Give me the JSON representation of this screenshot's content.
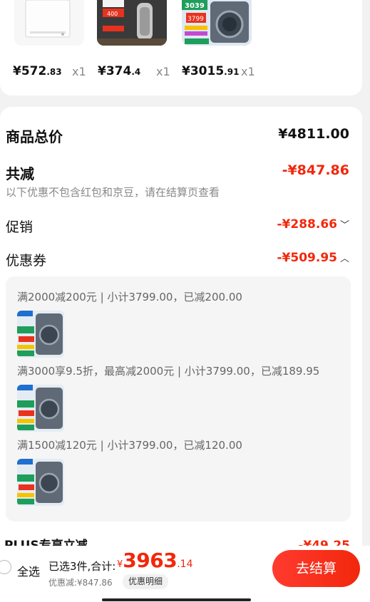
{
  "top_products": [
    {
      "price_int": "¥572",
      "price_dec": ".83",
      "qty": "x1",
      "icon": "freezer-image"
    },
    {
      "price_int": "¥374",
      "price_dec": ".4",
      "qty": "x1",
      "icon": "water-purifier-image"
    },
    {
      "price_int": "¥3015",
      "price_dec": ".91",
      "qty": "x1",
      "icon": "washing-machine-image"
    }
  ],
  "summary": {
    "goods_total_label": "商品总价",
    "goods_total_value": "¥4811.00",
    "total_reduce_label": "共减",
    "total_reduce_value": "-¥847.86",
    "note": "以下优惠不包含红包和京豆，请在结算页查看",
    "promo_label": "促销",
    "promo_value": "-¥288.66",
    "coupon_label": "优惠券",
    "coupon_value": "-¥509.95"
  },
  "coupons": [
    {
      "text": "满2000减200元 | 小计3799.00，已减200.00"
    },
    {
      "text": "满3000享9.5折，最高减2000元 | 小计3799.00，已减189.95"
    },
    {
      "text": "满1500减120元 | 小计3799.00，已减120.00"
    }
  ],
  "peek": {
    "label": "PLUS专享立减",
    "value": "-¥49.25"
  },
  "bottom": {
    "select_all": "全选",
    "selected_text": "已选3件,合计:",
    "currency": "¥",
    "total_int": "3963",
    "total_dec": ".14",
    "discount_text": "优惠减:¥847.86",
    "detail_button": "优惠明细",
    "checkout_button": "去结算"
  },
  "colors": {
    "accent": "#f2270c",
    "background": "#f2f2f2"
  }
}
